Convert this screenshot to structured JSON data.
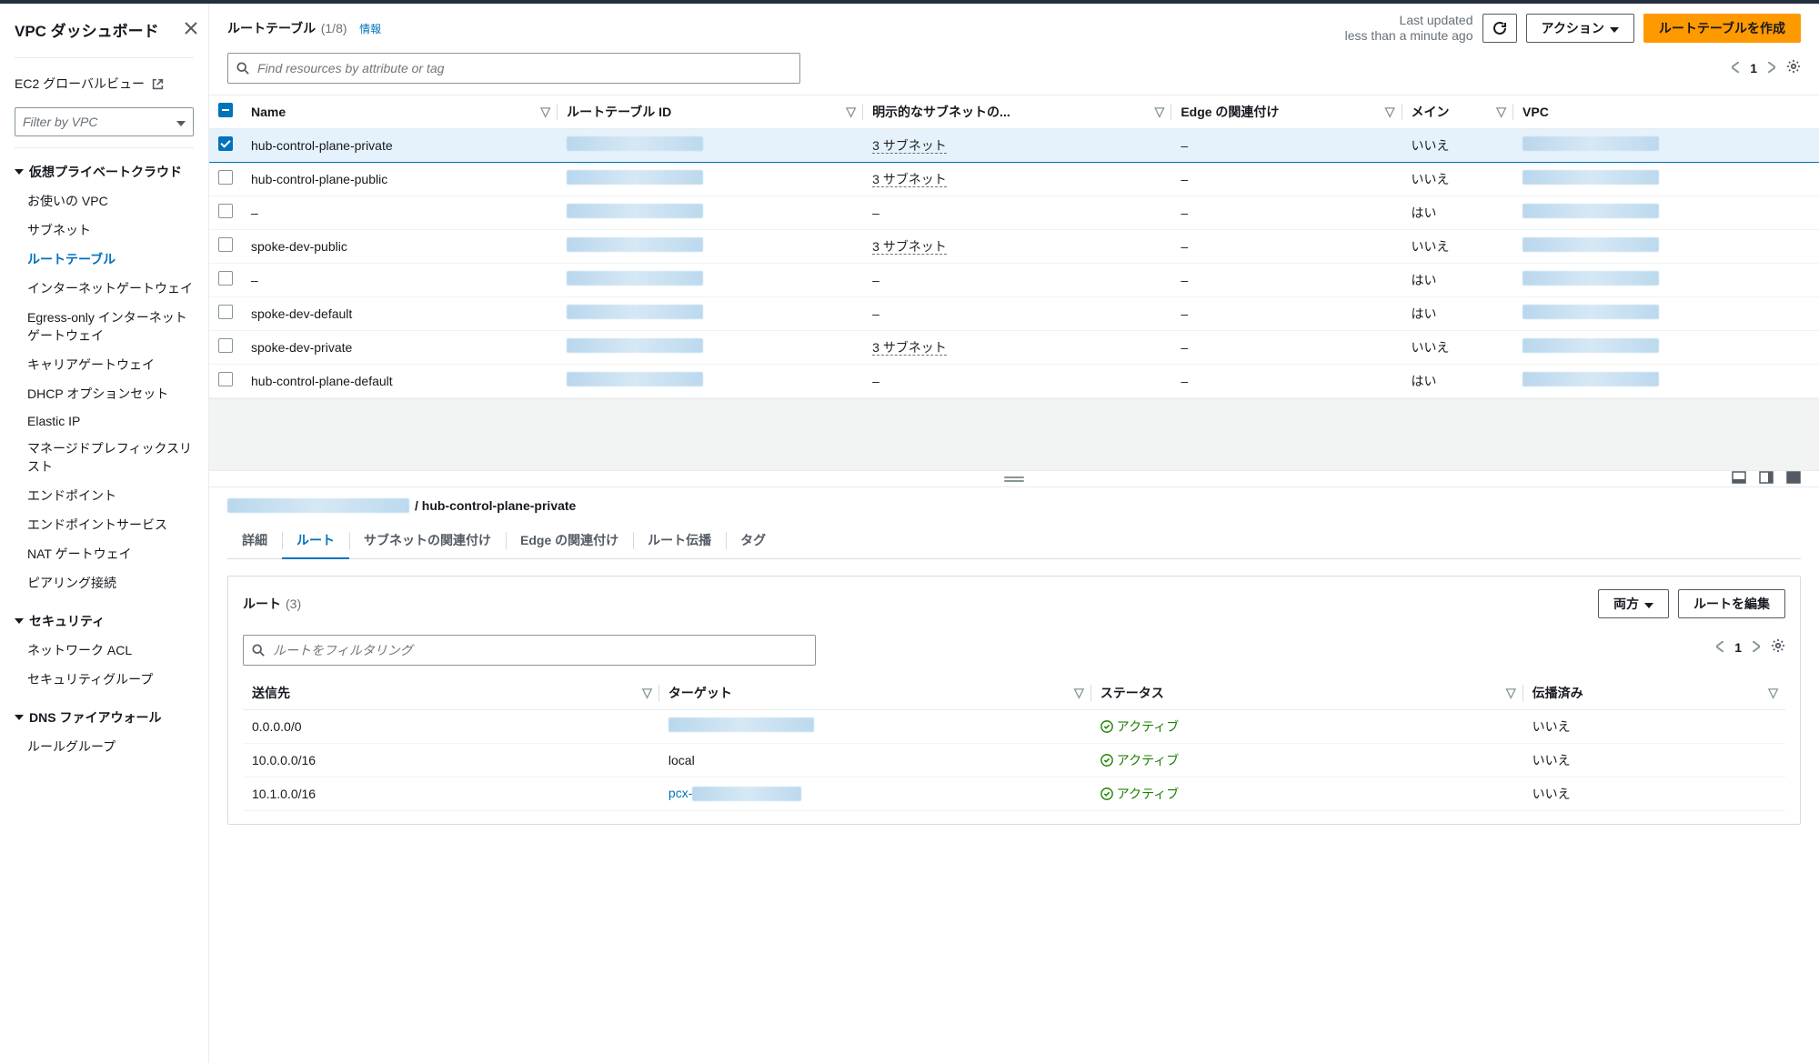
{
  "sidebar": {
    "title": "VPC ダッシュボード",
    "ec2_global": "EC2 グローバルビュー",
    "filter_placeholder": "Filter by VPC",
    "groups": [
      {
        "label": "仮想プライベートクラウド",
        "items": [
          {
            "label": "お使いの VPC"
          },
          {
            "label": "サブネット"
          },
          {
            "label": "ルートテーブル",
            "active": true
          },
          {
            "label": "インターネットゲートウェイ"
          },
          {
            "label": "Egress-only インターネットゲートウェイ"
          },
          {
            "label": "キャリアゲートウェイ"
          },
          {
            "label": "DHCP オプションセット"
          },
          {
            "label": "Elastic IP"
          },
          {
            "label": "マネージドプレフィックスリスト"
          },
          {
            "label": "エンドポイント"
          },
          {
            "label": "エンドポイントサービス"
          },
          {
            "label": "NAT ゲートウェイ"
          },
          {
            "label": "ピアリング接続"
          }
        ]
      },
      {
        "label": "セキュリティ",
        "items": [
          {
            "label": "ネットワーク ACL"
          },
          {
            "label": "セキュリティグループ"
          }
        ]
      },
      {
        "label": "DNS ファイアウォール",
        "items": [
          {
            "label": "ルールグループ"
          }
        ]
      }
    ]
  },
  "header": {
    "title": "ルートテーブル",
    "count": "(1/8)",
    "info": "情報",
    "last_updated_label": "Last updated",
    "last_updated_value": "less than a minute ago",
    "actions_btn": "アクション",
    "create_btn": "ルートテーブルを作成",
    "search_placeholder": "Find resources by attribute or tag",
    "page": "1"
  },
  "columns": {
    "name": "Name",
    "rt_id": "ルートテーブル ID",
    "explicit": "明示的なサブネットの...",
    "edge": "Edge の関連付け",
    "main": "メイン",
    "vpc": "VPC"
  },
  "rows": [
    {
      "selected": true,
      "name": "hub-control-plane-private",
      "subnets": "3 サブネット",
      "edge": "–",
      "main": "いいえ"
    },
    {
      "name": "hub-control-plane-public",
      "subnets": "3 サブネット",
      "edge": "–",
      "main": "いいえ"
    },
    {
      "name": "–",
      "subnets": "–",
      "edge": "–",
      "main": "はい"
    },
    {
      "name": "spoke-dev-public",
      "subnets": "3 サブネット",
      "edge": "–",
      "main": "いいえ"
    },
    {
      "name": "–",
      "subnets": "–",
      "edge": "–",
      "main": "はい"
    },
    {
      "name": "spoke-dev-default",
      "subnets": "–",
      "edge": "–",
      "main": "はい"
    },
    {
      "name": "spoke-dev-private",
      "subnets": "3 サブネット",
      "edge": "–",
      "main": "いいえ"
    },
    {
      "name": "hub-control-plane-default",
      "subnets": "–",
      "edge": "–",
      "main": "はい"
    }
  ],
  "detail": {
    "title": " / hub-control-plane-private",
    "tabs": [
      "詳細",
      "ルート",
      "サブネットの関連付け",
      "Edge の関連付け",
      "ルート伝播",
      "タグ"
    ],
    "active_tab": 1,
    "routes_title": "ルート",
    "routes_count": "(3)",
    "filter_dropdown": "両方",
    "edit_btn": "ルートを編集",
    "routes_search_placeholder": "ルートをフィルタリング",
    "page": "1",
    "columns": {
      "dest": "送信先",
      "target": "ターゲット",
      "status": "ステータス",
      "propagated": "伝播済み"
    },
    "status_active": "アクティブ",
    "routes": [
      {
        "dest": "0.0.0.0/0",
        "target_redacted": true,
        "propagated": "いいえ"
      },
      {
        "dest": "10.0.0.0/16",
        "target": "local",
        "propagated": "いいえ"
      },
      {
        "dest": "10.1.0.0/16",
        "target_prefix": "pcx-",
        "target_redacted": true,
        "propagated": "いいえ"
      }
    ]
  }
}
